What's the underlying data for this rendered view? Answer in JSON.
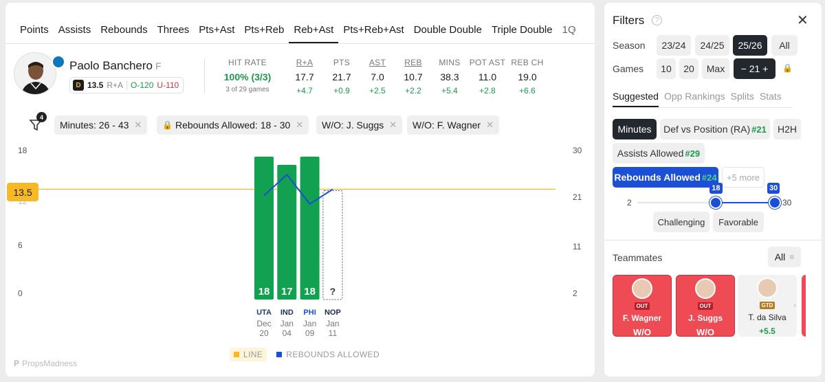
{
  "tabs": [
    "Points",
    "Assists",
    "Rebounds",
    "Threes",
    "Pts+Ast",
    "Pts+Reb",
    "Reb+Ast",
    "Pts+Reb+Ast",
    "Double Double",
    "Triple Double",
    "1Q"
  ],
  "active_tab": "Reb+Ast",
  "player": {
    "name": "Paolo Banchero",
    "position": "F",
    "line": "13.5",
    "market": "R+A",
    "over": "O-120",
    "under": "U-110"
  },
  "stats": {
    "hit_rate_label": "HIT RATE",
    "hit_rate_value": "100% (3/3)",
    "hit_rate_sub": "3 of 29 games",
    "columns": [
      {
        "label": "R+A",
        "value": "17.7",
        "delta": "+4.7",
        "underline": true
      },
      {
        "label": "PTS",
        "value": "21.7",
        "delta": "+0.9",
        "underline": false
      },
      {
        "label": "AST",
        "value": "7.0",
        "delta": "+2.5",
        "underline": true
      },
      {
        "label": "REB",
        "value": "10.7",
        "delta": "+2.2",
        "underline": true
      },
      {
        "label": "MINS",
        "value": "38.3",
        "delta": "+5.4",
        "underline": false
      },
      {
        "label": "POT AST",
        "value": "11.0",
        "delta": "+2.8",
        "underline": false
      },
      {
        "label": "REB CH",
        "value": "19.0",
        "delta": "+6.6",
        "underline": false
      }
    ]
  },
  "filter_count": "4",
  "chips": {
    "minutes": "Minutes: 26 - 43",
    "rebounds": "Rebounds Allowed: 18 - 30",
    "suggs": "W/O: J. Suggs",
    "wagner": "W/O: F. Wagner"
  },
  "chart_data": {
    "type": "bar",
    "categories": [
      "Dec 20",
      "Jan 04",
      "Jan 09",
      "Jan 11"
    ],
    "values": [
      18,
      17,
      18,
      null
    ],
    "bar_labels": [
      "18",
      "17",
      "18",
      "?"
    ],
    "line": 13.5,
    "line_label": "13.5",
    "left_ticks": [
      "18",
      "12",
      "6",
      "0"
    ],
    "right_ticks": [
      "30",
      "21",
      "11",
      "2"
    ],
    "ylim": [
      0,
      18
    ],
    "y2lim": [
      2,
      30
    ],
    "series": [
      {
        "name": "REBOUNDS ALLOWED",
        "values": [
          21.8,
          25.8,
          20.2,
          23.0
        ]
      }
    ],
    "opponent_logos": [
      "UTA",
      "IND",
      "PHI",
      "NOP"
    ],
    "legend": [
      "LINE",
      "REBOUNDS ALLOWED"
    ],
    "colors": {
      "bar": "#12a150",
      "line": "#f7b928",
      "series": "#1a4fd6"
    }
  },
  "watermark": "PropsMadness",
  "sidebar": {
    "title": "Filters",
    "season_label": "Season",
    "seasons": [
      "23/24",
      "24/25",
      "25/26",
      "All"
    ],
    "active_season": "25/26",
    "games_label": "Games",
    "games": [
      "10",
      "20",
      "Max"
    ],
    "games_custom": "−  21  +",
    "subtabs": [
      "Suggested",
      "Opp Rankings",
      "Splits",
      "Stats"
    ],
    "suggested": {
      "minutes": "Minutes",
      "def_vs_pos": "Def vs Position (RA)",
      "def_vs_pos_rank": "#21",
      "h2h": "H2H",
      "assists_allowed": "Assists Allowed",
      "assists_allowed_rank": "#29",
      "rebounds_allowed": "Rebounds Allowed",
      "rebounds_allowed_rank": "#24",
      "more": "+5 more"
    },
    "slider": {
      "min": "2",
      "max": "30",
      "low": "18",
      "high": "30",
      "low_value": 18,
      "high_value": 30
    },
    "challenging": "Challenging",
    "favorable": "Favorable",
    "teammates_label": "Teammates",
    "teammates_filter": "All",
    "teammates": [
      {
        "name": "F. Wagner",
        "status": "OUT",
        "tag": "W/O"
      },
      {
        "name": "J. Suggs",
        "status": "OUT",
        "tag": "W/O"
      },
      {
        "name": "T. da Silva",
        "status": "GTD",
        "tag": "+5.5"
      }
    ]
  }
}
